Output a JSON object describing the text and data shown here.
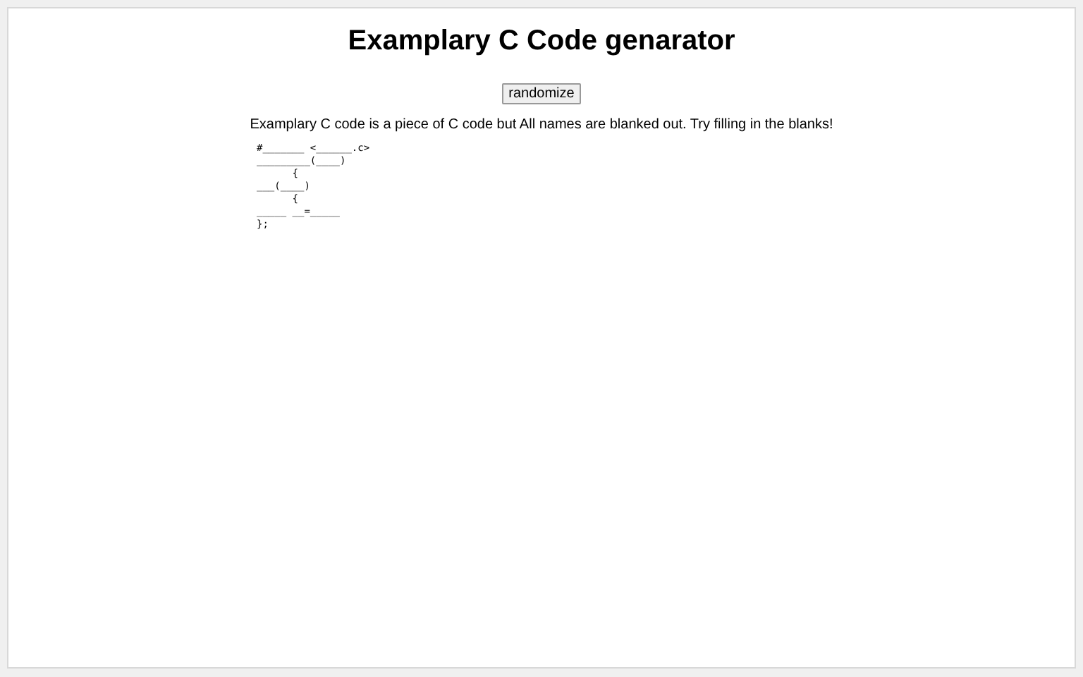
{
  "title": "Examplary C Code genarator",
  "button": "randomize",
  "description": "Examplary C code is a piece of C code but All names are blanked out. Try filling in the blanks!",
  "code_lines": [
    "#_______ <______.c>",
    "_________(____)",
    "      {",
    "___(____)",
    "      {",
    "_____ __=_____",
    "};"
  ]
}
